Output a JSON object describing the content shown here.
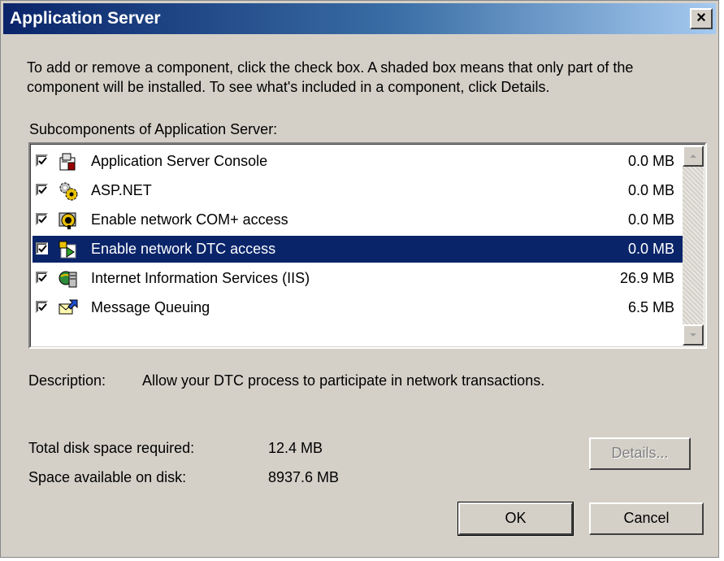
{
  "window": {
    "title": "Application Server",
    "close_glyph": "×"
  },
  "intro_text": "To add or remove a component, click the check box. A shaded box means that only part of the component will be installed. To see what's included in a component, click Details.",
  "subcomponents_label": "Subcomponents of Application Server:",
  "components": [
    {
      "name": "Application Server Console",
      "size": "0.0 MB",
      "checked": true,
      "selected": false,
      "icon": "console-icon"
    },
    {
      "name": "ASP.NET",
      "size": "0.0 MB",
      "checked": true,
      "selected": false,
      "icon": "gears-icon"
    },
    {
      "name": "Enable network COM+ access",
      "size": "0.0 MB",
      "checked": true,
      "selected": false,
      "icon": "com-plus-icon"
    },
    {
      "name": "Enable network DTC access",
      "size": "0.0 MB",
      "checked": true,
      "selected": true,
      "icon": "dtc-icon"
    },
    {
      "name": "Internet Information Services (IIS)",
      "size": "26.9 MB",
      "checked": true,
      "selected": false,
      "icon": "iis-icon"
    },
    {
      "name": "Message Queuing",
      "size": "6.5 MB",
      "checked": true,
      "selected": false,
      "icon": "message-queue-icon"
    }
  ],
  "description": {
    "label": "Description:",
    "text": "Allow your DTC process to participate in network transactions."
  },
  "disk": {
    "required_label": "Total disk space required:",
    "required_value": "12.4 MB",
    "available_label": "Space available on disk:",
    "available_value": "8937.6 MB"
  },
  "buttons": {
    "details": "Details...",
    "ok": "OK",
    "cancel": "Cancel"
  },
  "colors": {
    "selection": "#0a246a",
    "face": "#d4d0c8"
  }
}
